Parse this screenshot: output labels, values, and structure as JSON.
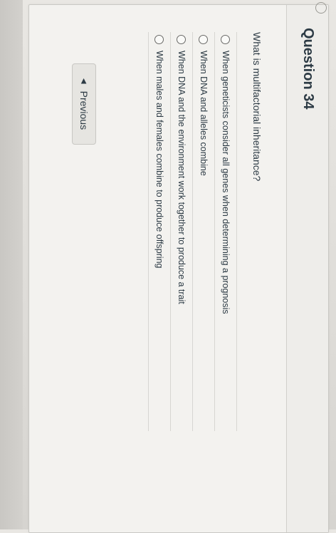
{
  "question": {
    "title": "Question 34",
    "text": "What is multifactorial inheritance?"
  },
  "answers": [
    {
      "label": "When geneticists consider all genes when determining a prognosis"
    },
    {
      "label": "When DNA and alleles combine"
    },
    {
      "label": "When DNA and the environment work together to produce a trait"
    },
    {
      "label": "When males and females combine to produce offspring"
    }
  ],
  "navigation": {
    "previous_label": "Previous",
    "previous_icon": "chevron-left-icon"
  }
}
